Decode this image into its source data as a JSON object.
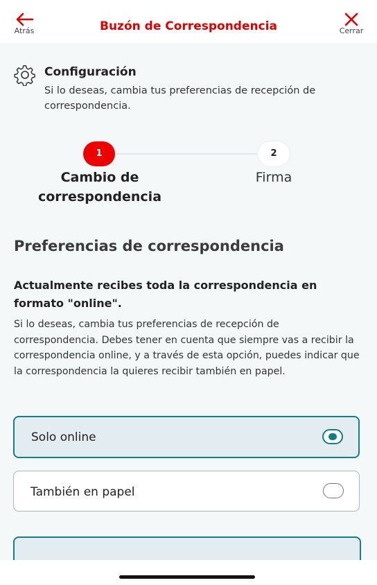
{
  "header": {
    "back_label": "Atrás",
    "title": "Buzón de Correspondencia",
    "close_label": "Cerrar",
    "accent_color": "#e00000"
  },
  "config": {
    "icon": "gear-icon",
    "title": "Configuración",
    "text": "Si lo deseas, cambia tus preferencias de recepción de correspondencia."
  },
  "stepper": {
    "steps": [
      {
        "number": "1",
        "label": "Cambio de correspondencia",
        "active": true
      },
      {
        "number": "2",
        "label": "Firma",
        "active": false
      }
    ]
  },
  "section": {
    "title": "Preferencias de correspondencia",
    "current": "Actualmente recibes toda la correspondencia en formato \"online\".",
    "body": "Si lo deseas, cambia tus preferencias de recepción de correspondencia. Debes tener en cuenta que siempre vas a recibir la correspondencia online, y a través de esta opción, puedes indicar que la correspondencia la quieres recibir también en papel."
  },
  "options": [
    {
      "label": "Solo online",
      "selected": true
    },
    {
      "label": "También en papel",
      "selected": false
    }
  ],
  "colors": {
    "selected_border": "#137e84",
    "selected_bg": "#e3edf1"
  }
}
